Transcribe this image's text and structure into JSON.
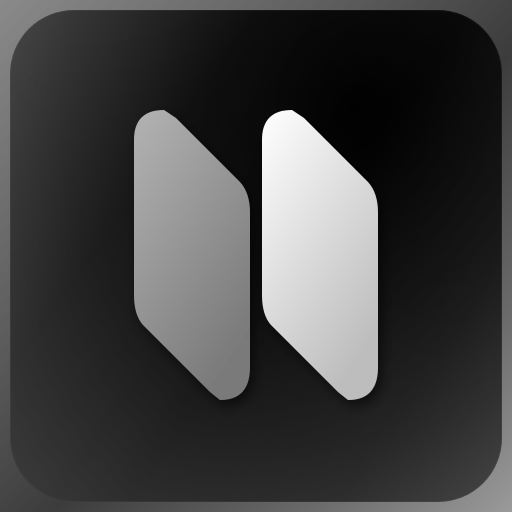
{
  "icon": {
    "name": "double-slash-logo-icon",
    "colors": {
      "background_dark": "#000000",
      "background_edge": "#3a3a3a",
      "left_bar_top": "#b3b3b3",
      "left_bar_bottom": "#7a7a7a",
      "right_bar_top": "#ffffff",
      "right_bar_bottom": "#bdbdbd"
    }
  }
}
